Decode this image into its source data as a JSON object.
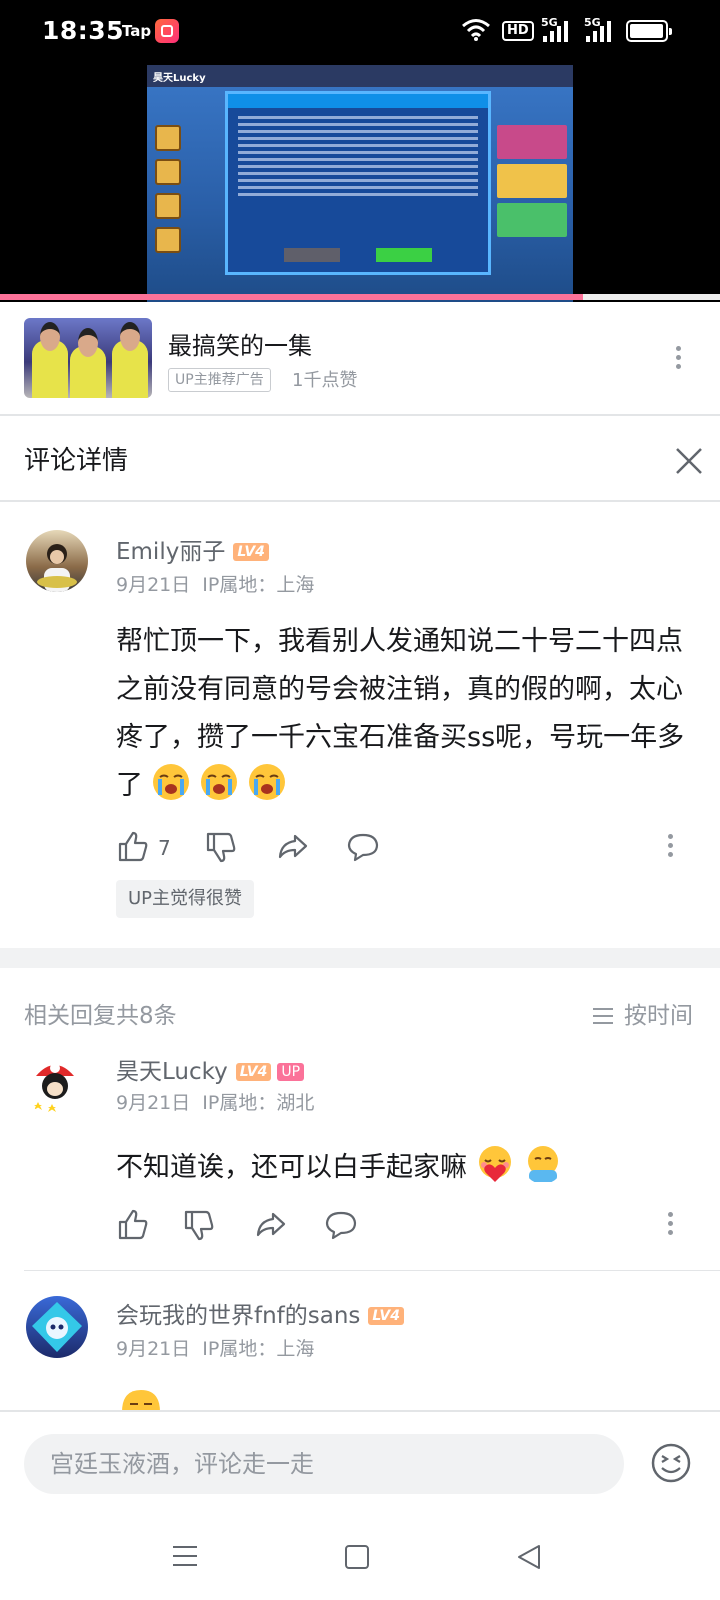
{
  "status_bar": {
    "time": "18:35",
    "carrier_text": "Tap",
    "hd_label": "HD",
    "signal_1_label": "5G",
    "signal_2_label": "5G",
    "icons": [
      "app-icon",
      "wifi-icon",
      "signal-icon",
      "battery-icon"
    ]
  },
  "video": {
    "watermark": "昊天Lucky",
    "progress_fraction": 0.81,
    "accent_color": "#fb7299"
  },
  "ad": {
    "title": "最搞笑的一集",
    "badge": "UP主推荐广告",
    "likes": "1千点赞"
  },
  "header": {
    "title": "评论详情"
  },
  "main_comment": {
    "username": "Emily丽子",
    "level": "LV4",
    "date": "9月21日",
    "location": "IP属地：上海",
    "text": "帮忙顶一下，我看别人发通知说二十号二十四点之前没有同意的号会被注销，真的假的啊，太心疼了，攒了一千六宝石准备买ss呢，号玩一年多了",
    "like_count": "7",
    "up_tag": "UP主觉得很赞",
    "emojis": [
      "crying-emoji",
      "crying-emoji",
      "crying-emoji"
    ]
  },
  "replies_header": {
    "label": "相关回复共8条",
    "sort_label": "按时间"
  },
  "replies": [
    {
      "username": "昊天Lucky",
      "level": "LV4",
      "up_badge": "UP",
      "date": "9月21日",
      "location": "IP属地：湖北",
      "text": "不知道诶，还可以白手起家嘛",
      "emojis": [
        "heart-hug-emoji",
        "hug-emoji"
      ]
    },
    {
      "username": "会玩我的世界fnf的sans",
      "level": "LV4",
      "date": "9月21日",
      "location": "IP属地：上海"
    }
  ],
  "input": {
    "placeholder": "宫廷玉液酒，评论走一走"
  }
}
